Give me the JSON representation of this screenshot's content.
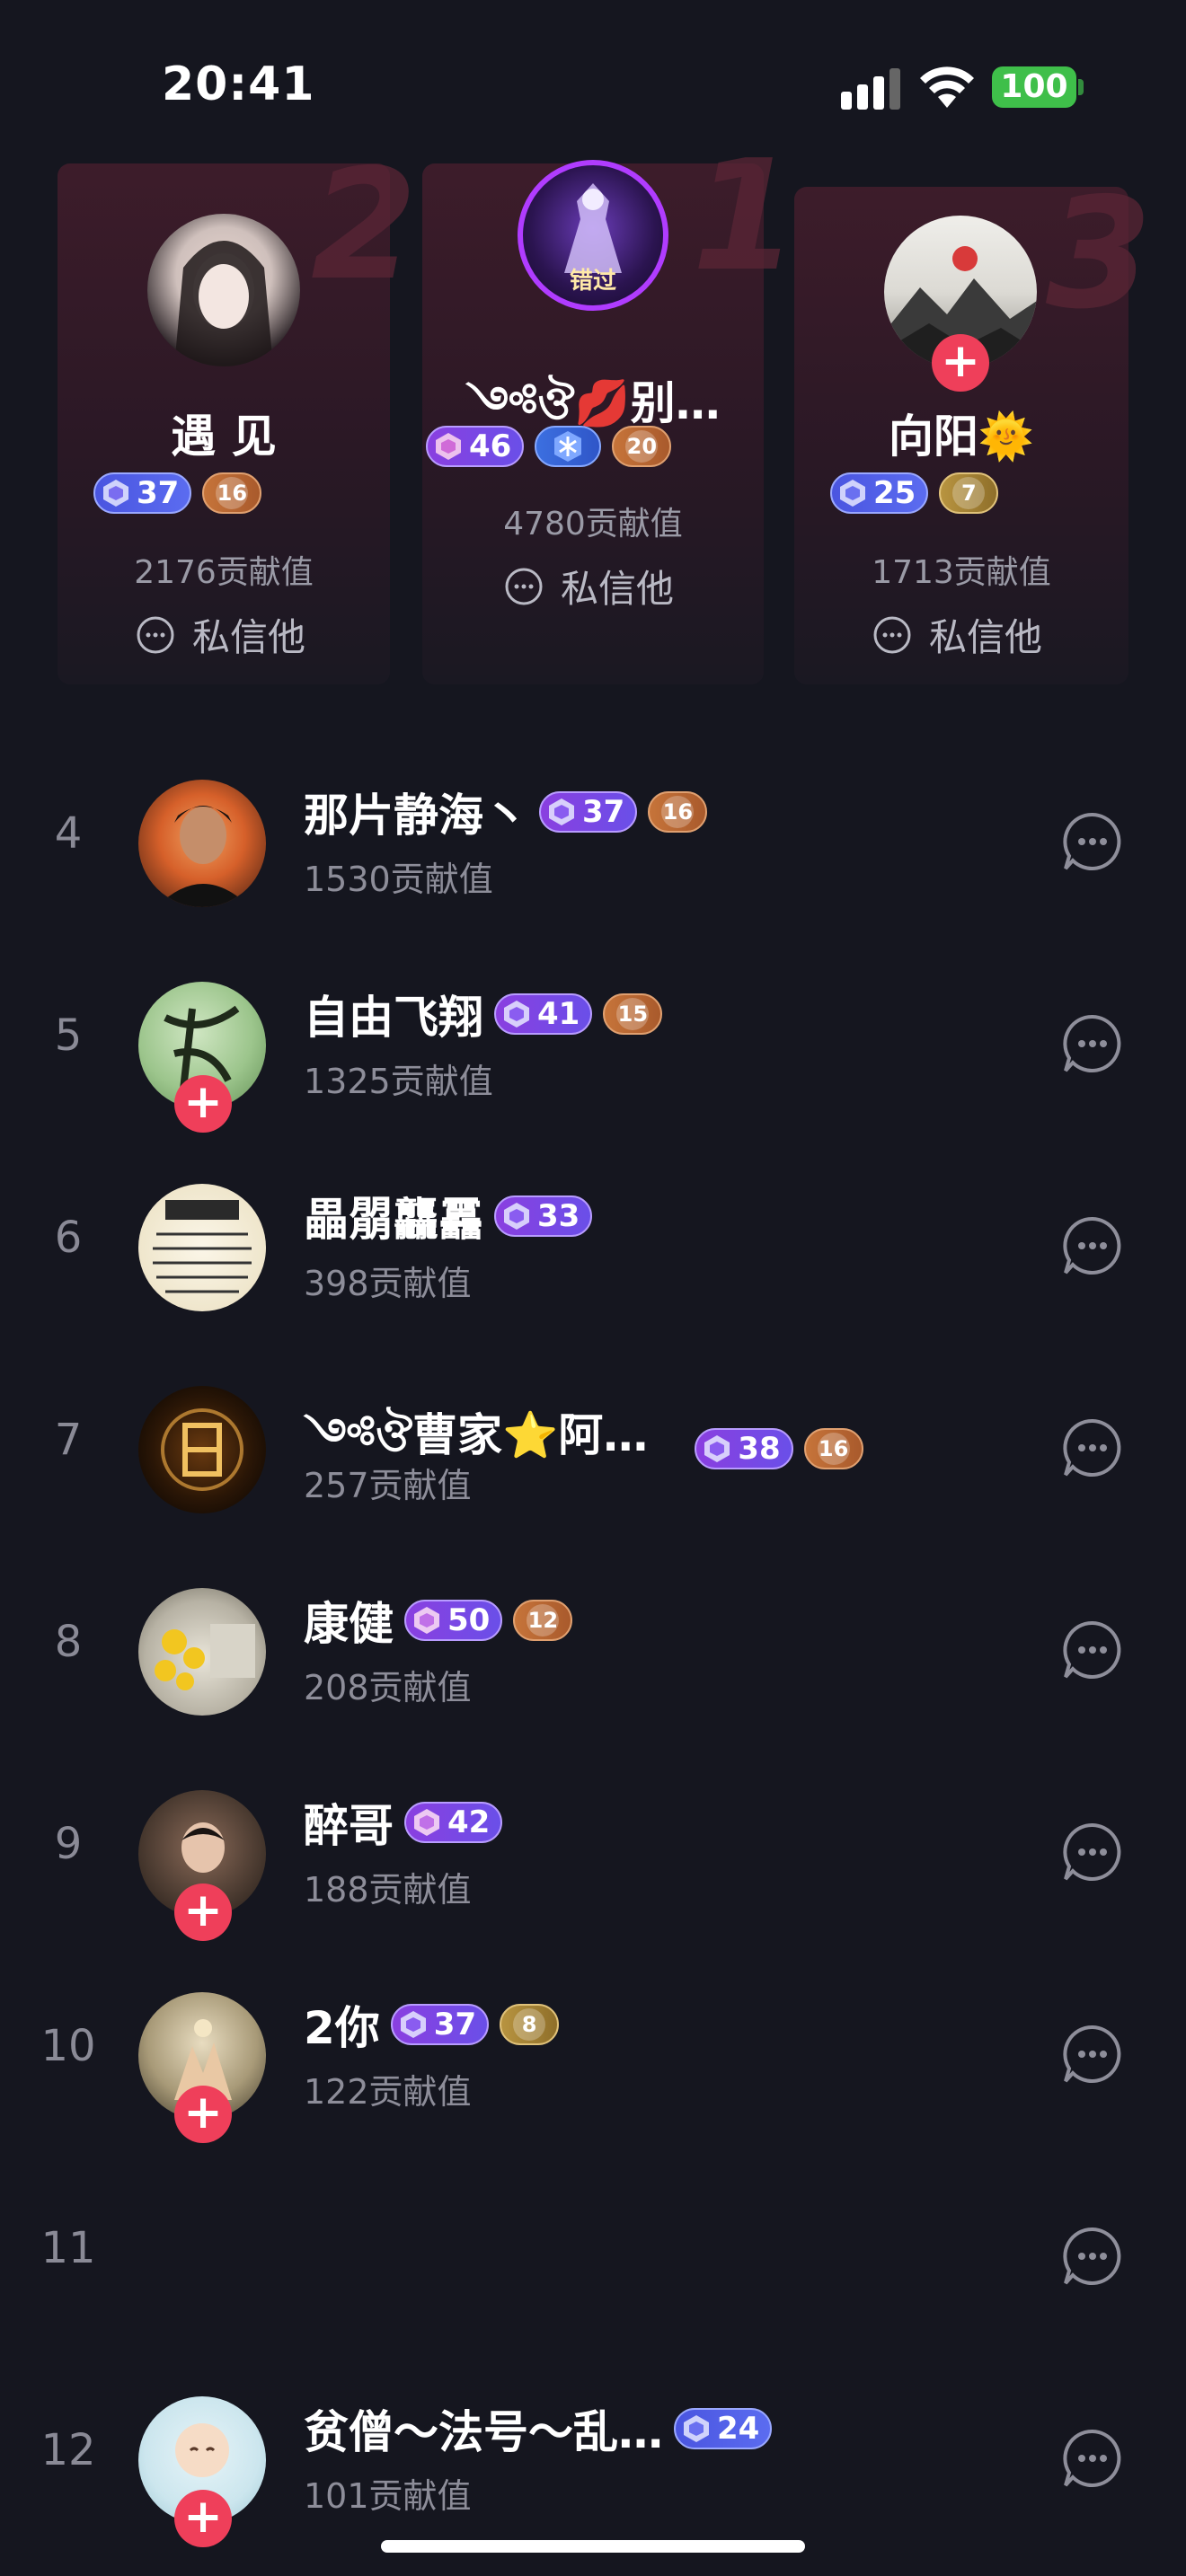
{
  "status_bar": {
    "time": "20:41",
    "battery": "100",
    "icons": [
      "signal-icon",
      "wifi-icon",
      "battery-icon"
    ]
  },
  "podium": [
    {
      "rank": "2",
      "name": "遇 见",
      "level": "37",
      "fan_level": "16",
      "contribution": "2176贡献值",
      "message_label": "私信他"
    },
    {
      "rank": "1",
      "name": "༺ঔ💋别…",
      "level": "46",
      "fan_level": "20",
      "contribution": "4780贡献值",
      "message_label": "私信他",
      "avatar_text": "错过"
    },
    {
      "rank": "3",
      "name": "向阳🌞",
      "level": "25",
      "fan_level": "7",
      "contribution": "1713贡献值",
      "message_label": "私信他"
    }
  ],
  "list": [
    {
      "rank": "4",
      "name": "那片静海丶",
      "level": "37",
      "fan_level": "16",
      "contribution": "1530贡献值"
    },
    {
      "rank": "5",
      "name": "自由飞翔",
      "level": "41",
      "fan_level": "15",
      "contribution": "1325贡献值"
    },
    {
      "rank": "6",
      "name": "畾朤龘靐",
      "level": "33",
      "fan_level": "",
      "contribution": "398贡献值"
    },
    {
      "rank": "7",
      "name": "༺ঔ曹家⭐阿…",
      "level": "38",
      "fan_level": "16",
      "contribution": "257贡献值"
    },
    {
      "rank": "8",
      "name": "康健",
      "level": "50",
      "fan_level": "12",
      "contribution": "208贡献值"
    },
    {
      "rank": "9",
      "name": "醉哥",
      "level": "42",
      "fan_level": "",
      "contribution": "188贡献值"
    },
    {
      "rank": "10",
      "name": "2你",
      "level": "37",
      "fan_level": "8",
      "contribution": "122贡献值"
    },
    {
      "rank": "11",
      "name": "",
      "level": "",
      "fan_level": "",
      "contribution": ""
    },
    {
      "rank": "12",
      "name": "贫僧～法号～乱…",
      "level": "24",
      "fan_level": "",
      "contribution": "101贡献值"
    }
  ],
  "colors": {
    "background": "#15161f",
    "accent_red": "#ef3f5a",
    "level_badge": "#7a48e6",
    "fan_badge": "#c6743a"
  }
}
